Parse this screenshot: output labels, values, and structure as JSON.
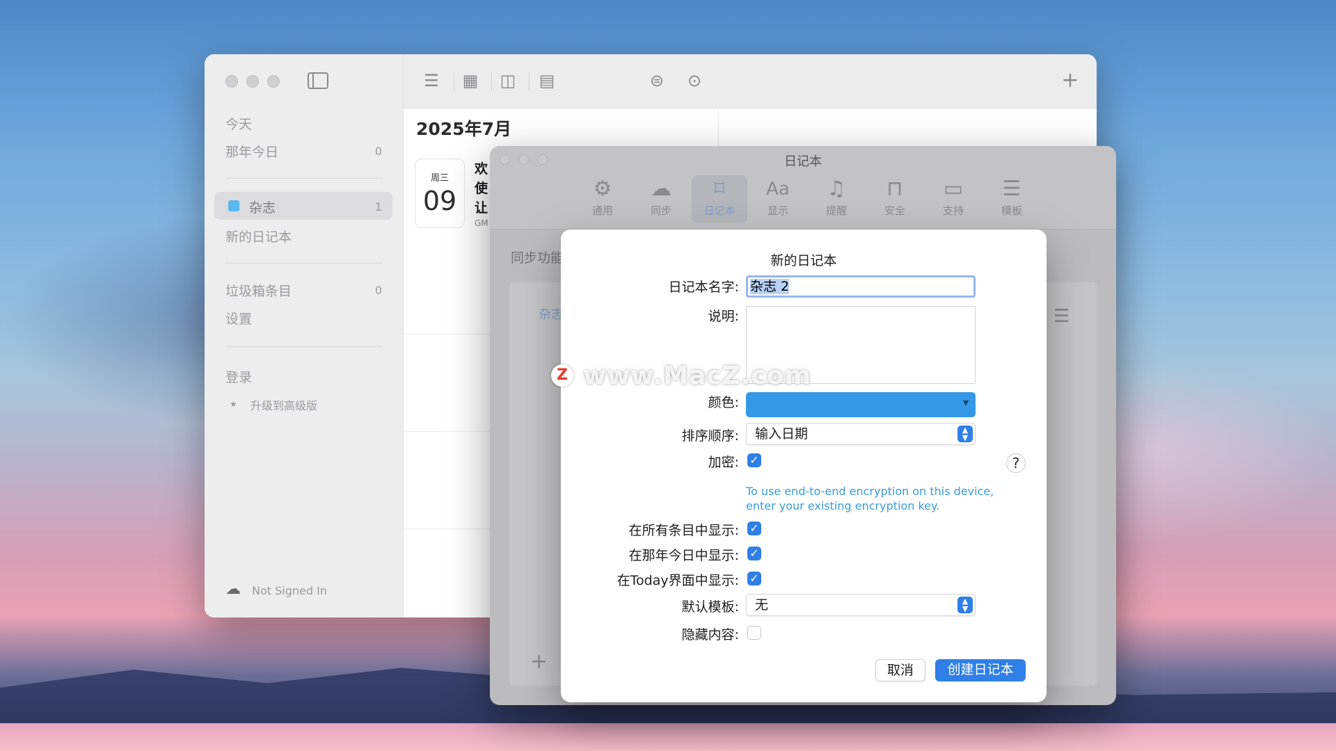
{
  "sidebar": {
    "today": "今天",
    "on_this_day": {
      "label": "那年今日",
      "count": "0"
    },
    "journals": [
      {
        "label": "杂志",
        "count": "1",
        "color": "#5ab8f0"
      }
    ],
    "new_journal": "新的日记本",
    "trash": {
      "label": "垃圾箱条目",
      "count": "0"
    },
    "settings": "设置",
    "login": "登录",
    "upgrade": "升级到高级版",
    "sync_status": "Not Signed In"
  },
  "main": {
    "month_title": "2025年7月",
    "entry": {
      "weekday": "周三",
      "day": "09",
      "snippet_lines": [
        "欢",
        "使",
        "让"
      ],
      "gmt": "GM"
    }
  },
  "settings_window": {
    "title": "日记本",
    "tabs": [
      {
        "label": "通用",
        "icon": "gear-icon"
      },
      {
        "label": "同步",
        "icon": "cloud-icon"
      },
      {
        "label": "日记本",
        "icon": "bookmark-icon"
      },
      {
        "label": "显示",
        "icon": "text-format-icon"
      },
      {
        "label": "提醒",
        "icon": "bell-icon"
      },
      {
        "label": "安全",
        "icon": "lock-icon"
      },
      {
        "label": "支持",
        "icon": "chat-bubble-icon"
      },
      {
        "label": "模板",
        "icon": "list-icon"
      }
    ],
    "active_tab": "日记本",
    "sync_text": "同步功能",
    "inner_link": "杂志"
  },
  "dialog": {
    "title": "新的日记本",
    "name_label": "日记本名字:",
    "name_value": "杂志 2",
    "desc_label": "说明:",
    "color_label": "颜色:",
    "color_value": "#3598e6",
    "sort_label": "排序顺序:",
    "sort_value": "输入日期",
    "encrypt_label": "加密:",
    "encrypt_checked": true,
    "help": "?",
    "encrypt_hint": "To use end-to-end encryption on this device, enter your existing encryption key.",
    "show_all_label": "在所有条目中显示:",
    "show_onthisday_label": "在那年今日中显示:",
    "show_today_label": "在Today界面中显示:",
    "template_label": "默认模板:",
    "template_value": "无",
    "hide_label": "隐藏内容:",
    "cancel": "取消",
    "create": "创建日记本"
  },
  "watermark": "www.MacZ.com",
  "watermark_logo": "Z"
}
